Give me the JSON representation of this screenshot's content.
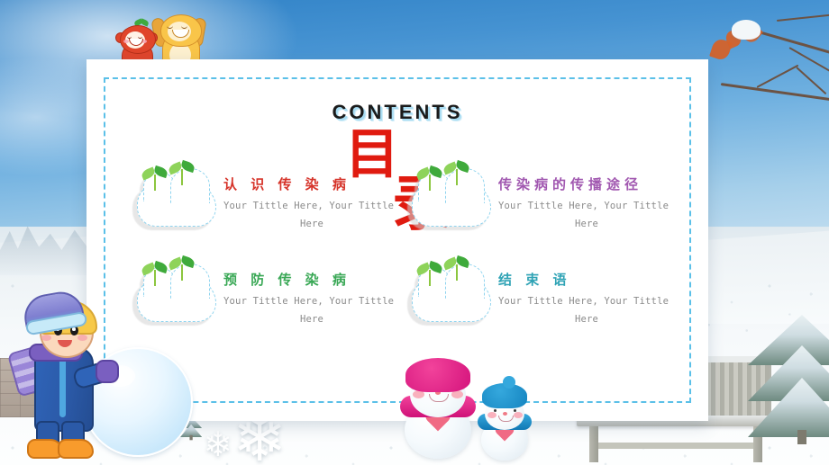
{
  "slide": {
    "heading_en": "CONTENTS",
    "heading_cn_char1": "目",
    "heading_cn_char2": "录",
    "accent_blue": "#5bc0e8",
    "heading_red": "#e01b10"
  },
  "items": [
    {
      "title": "认 识 传 染 病",
      "color": "#d6342a",
      "sub_line1": "Your Tittle Here, Your Tittle",
      "sub_line2": "Here",
      "icon": "cloud-sprout-icon"
    },
    {
      "title": "传染病的传播途径",
      "color": "#a158b0",
      "sub_line1": "Your Tittle Here, Your Tittle",
      "sub_line2": "Here",
      "icon": "cloud-sprout-icon"
    },
    {
      "title": "预 防 传 染 病",
      "color": "#3aa856",
      "sub_line1": "Your Tittle Here, Your Tittle",
      "sub_line2": "Here",
      "icon": "cloud-sprout-icon"
    },
    {
      "title": "结    束    语",
      "color": "#2fa3b5",
      "sub_line1": "Your Tittle Here, Your Tittle",
      "sub_line2": "Here",
      "icon": "cloud-sprout-icon"
    }
  ],
  "decorations": {
    "snowflake_large": "❄",
    "snowflake_small": "❄",
    "plush_monkey": "plush-monkey-toy",
    "plush_dog": "plush-dog-toy",
    "boy": "cartoon-boy-with-snowball",
    "snowman_large": "snowman-pink-hat",
    "snowman_small": "snowman-blue-hat",
    "pine_tree": "snow-covered-pine-tree",
    "bench": "snow-covered-bench",
    "branches": "bare-branches-with-maple-leaves"
  }
}
